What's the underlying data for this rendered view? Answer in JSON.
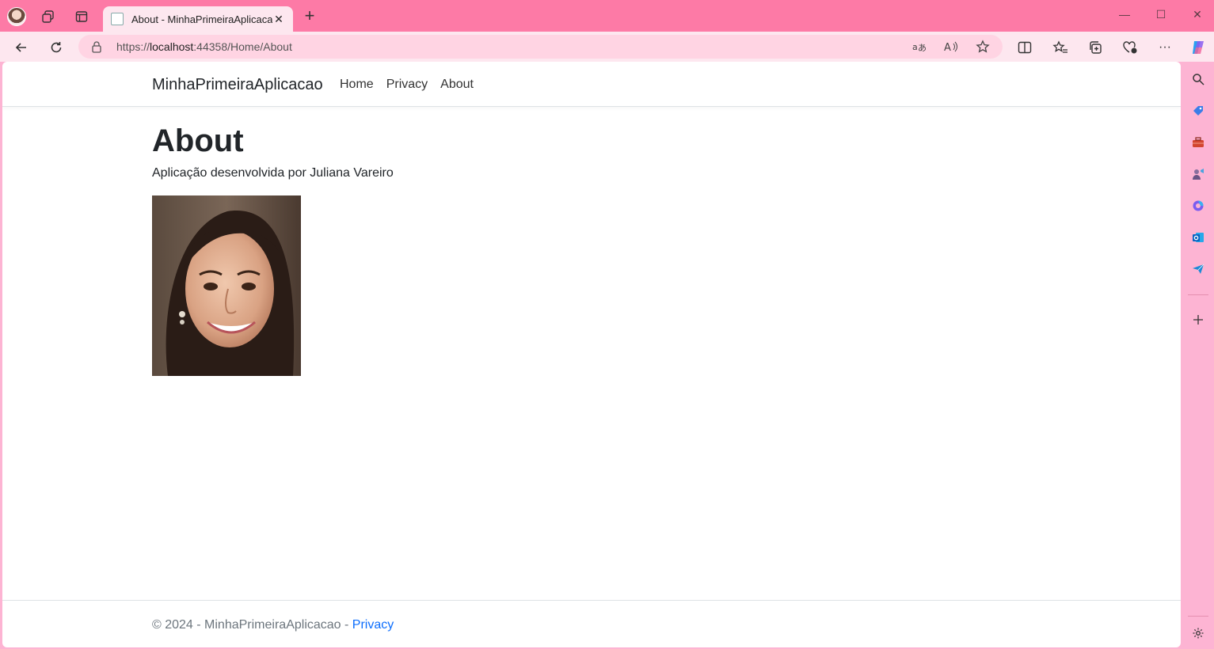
{
  "browser": {
    "tab_title": "About - MinhaPrimeiraAplicacao",
    "tab_close": "✕",
    "new_tab": "+",
    "url_prefix": "https://",
    "url_host": "localhost",
    "url_rest": ":44358/Home/About",
    "window_controls": [
      "—",
      "☐",
      "✕"
    ],
    "toolbar_more": "···",
    "icons": {
      "tabstrip": [
        "profile-avatar-icon",
        "workspaces-icon",
        "tab-actions-icon"
      ],
      "toolbar": [
        "back-icon",
        "refresh-icon",
        "lock-icon",
        "translate-icon",
        "read-aloud-icon",
        "favorite-star-icon",
        "split-screen-icon",
        "favorites-icon",
        "collections-icon",
        "browser-essentials-icon",
        "more-icon",
        "copilot-icon"
      ],
      "sidebar": [
        "search-icon",
        "shopping-tag-icon",
        "tools-icon",
        "games-icon",
        "microsoft365-icon",
        "outlook-icon",
        "send-icon",
        "add-icon",
        "settings-icon"
      ]
    }
  },
  "site": {
    "brand": "MinhaPrimeiraAplicacao",
    "nav": [
      "Home",
      "Privacy",
      "About"
    ],
    "heading": "About",
    "description": "Aplicação desenvolvida por Juliana Vareiro",
    "footer_text": "© 2024 - MinhaPrimeiraAplicacao - ",
    "footer_link": "Privacy"
  },
  "colors": {
    "tabstrip_bg": "#fd7aa6",
    "toolbar_bg": "#fde7ef",
    "sidebar_bg": "#fdb4d3",
    "link": "#0d6efd"
  }
}
